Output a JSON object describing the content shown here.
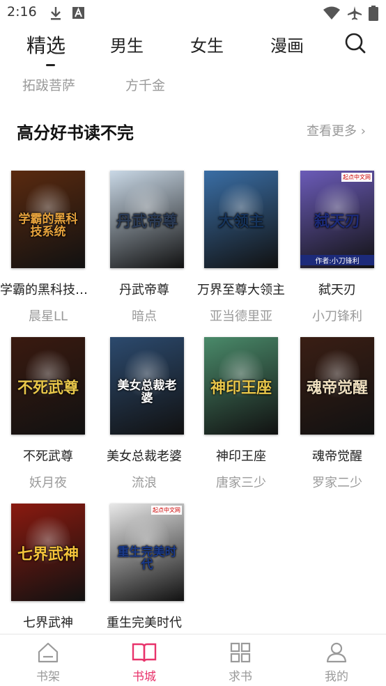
{
  "status_bar": {
    "time": "2:16"
  },
  "top_tabs": [
    {
      "label": "精选",
      "active": true
    },
    {
      "label": "男生",
      "active": false
    },
    {
      "label": "女生",
      "active": false
    },
    {
      "label": "漫画",
      "active": false
    }
  ],
  "prev_authors": [
    "拓跋菩萨",
    "方千金"
  ],
  "section": {
    "title": "高分好书读不完",
    "more": "查看更多 ›"
  },
  "books": [
    {
      "title": "学霸的黑科技系统",
      "author": "晨星LL",
      "cover_text": "学霸的黑科技系统",
      "cover_bg": "#5a2a10",
      "cover_fg": "#e6a23c"
    },
    {
      "title": "丹武帝尊",
      "author": "暗点",
      "cover_text": "丹武帝尊",
      "cover_bg": "#c9d8e6",
      "cover_fg": "#2b3b55"
    },
    {
      "title": "万界至尊大领主",
      "author": "亚当德里亚",
      "cover_text": "大领主",
      "cover_bg": "#3a6ea5",
      "cover_fg": "#16345c"
    },
    {
      "title": "弑天刃",
      "author": "小刀锋利",
      "cover_text": "弑天刃",
      "cover_bg": "#6b5bb8",
      "cover_fg": "#1c2a7a"
    },
    {
      "title": "不死武尊",
      "author": "妖月夜",
      "cover_text": "不死武尊",
      "cover_bg": "#3a1a10",
      "cover_fg": "#e8c64a"
    },
    {
      "title": "美女总裁老婆",
      "author": "流浪",
      "cover_text": "美女总裁老婆",
      "cover_bg": "#2c4a6e",
      "cover_fg": "#ffffff"
    },
    {
      "title": "神印王座",
      "author": "唐家三少",
      "cover_text": "神印王座",
      "cover_bg": "#4a8a6a",
      "cover_fg": "#e8c64a"
    },
    {
      "title": "魂帝觉醒",
      "author": "罗家二少",
      "cover_text": "魂帝觉醒",
      "cover_bg": "#3a1e14",
      "cover_fg": "#f0e0c0"
    },
    {
      "title": "七界武神",
      "author": "",
      "cover_text": "七界武神",
      "cover_bg": "#8a1a10",
      "cover_fg": "#f3c23a"
    },
    {
      "title": "重生完美时代",
      "author": "",
      "cover_text": "重生完美时代",
      "cover_bg": "#e8e8e8",
      "cover_fg": "#1a3a8a"
    }
  ],
  "cover_badges": {
    "small_site": "起点中文网",
    "byline_4": "作者:小刀锋利"
  },
  "bottom_nav": [
    {
      "label": "书架",
      "icon": "bookshelf-icon",
      "active": false
    },
    {
      "label": "书城",
      "icon": "book-open-icon",
      "active": true
    },
    {
      "label": "求书",
      "icon": "grid-icon",
      "active": false
    },
    {
      "label": "我的",
      "icon": "user-icon",
      "active": false
    }
  ],
  "colors": {
    "accent": "#e8336b",
    "muted": "#9a9a9a"
  }
}
